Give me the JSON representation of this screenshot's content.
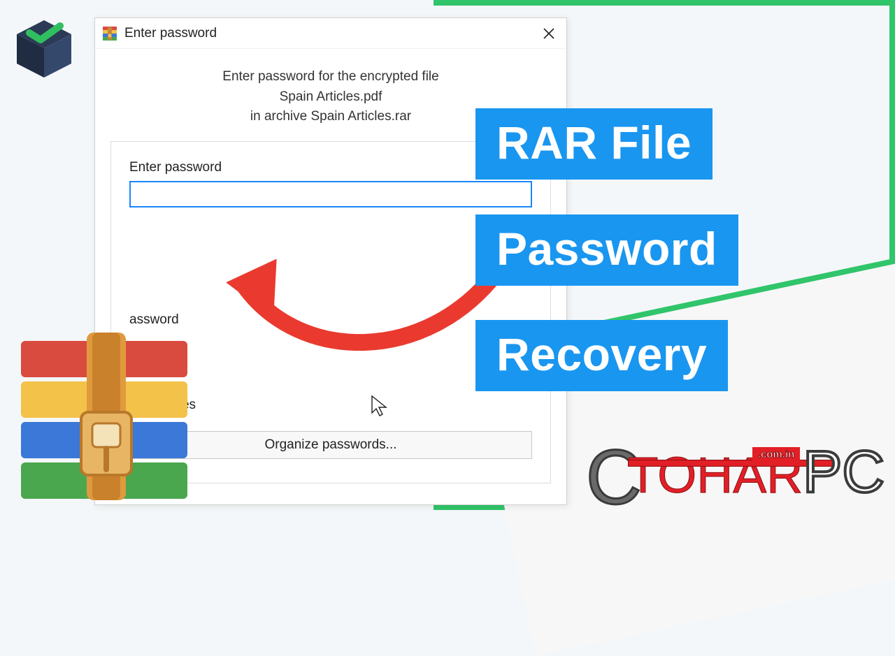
{
  "dialog": {
    "title": "Enter password",
    "prompt_line1": "Enter password for the encrypted file",
    "prompt_line2": "Spain Articles.pdf",
    "prompt_line3": "in archive Spain Articles.rar",
    "field_label": "Enter password",
    "password_value": "",
    "show_password_label": "assword",
    "all_archives_label": "all archives",
    "organize_label": "Organize passwords..."
  },
  "tags": {
    "t1": "RAR File",
    "t2": "Password",
    "t3": "Recovery"
  },
  "brand": {
    "c": "C",
    "tohar": "TOHAR",
    "comin": ".com.in",
    "pc": "PC"
  }
}
